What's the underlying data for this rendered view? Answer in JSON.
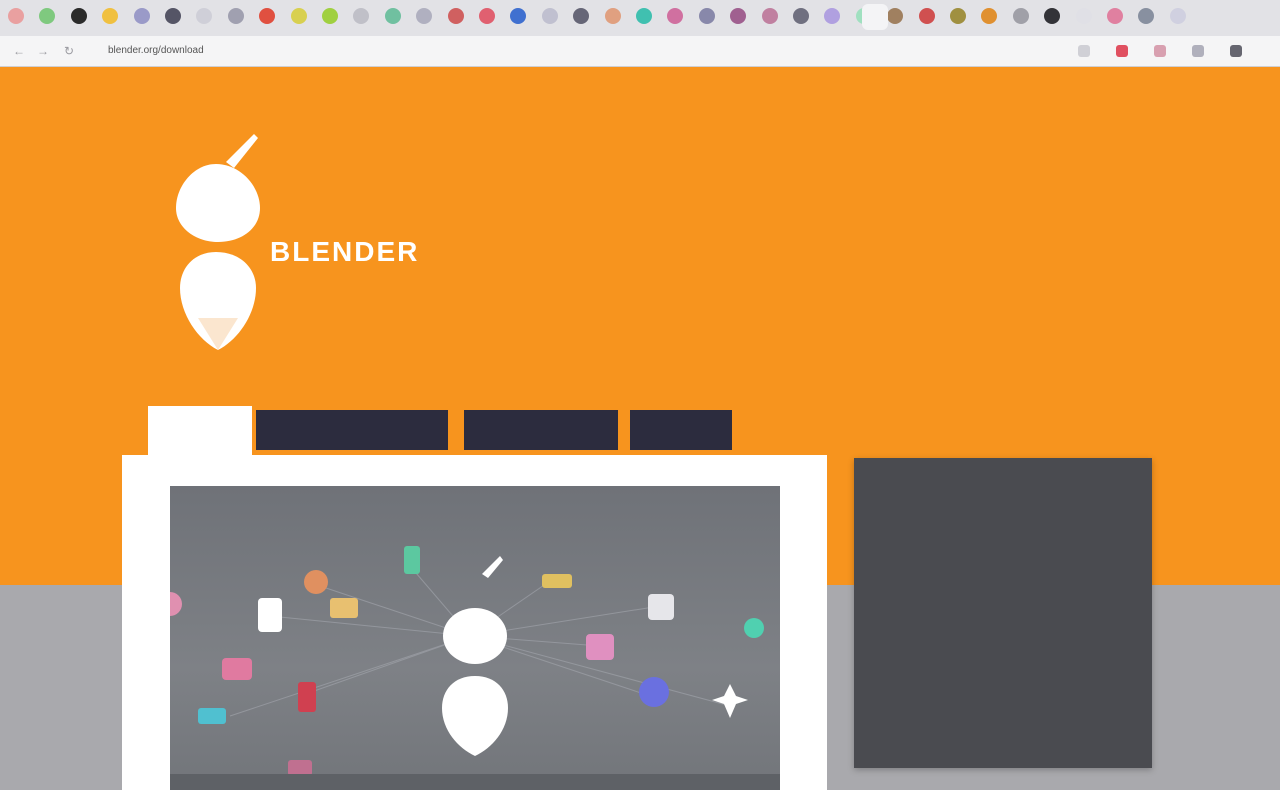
{
  "browser": {
    "url": "blender.org/download",
    "tab_colors": [
      "#e9a0a0",
      "#7fc97f",
      "#2b2b2b",
      "#f0c040",
      "#9a9ac8",
      "#555566",
      "#cfcfd8",
      "#a0a0b0",
      "#e05040",
      "#d8d050",
      "#a0d040",
      "#c0c0c8",
      "#70c0a0",
      "#b0b0c0",
      "#d06060",
      "#e06070",
      "#4070d0",
      "#c0c0d0",
      "#666677",
      "#e0a080",
      "#40c0b0",
      "#d070a0",
      "#8888aa",
      "#a06090",
      "#c080a0",
      "#707080",
      "#b0a0e0",
      "#a0e0c0",
      "#a08060",
      "#d05050",
      "#a09040",
      "#e09030",
      "#a0a0a8",
      "#333338",
      "#e0e0e6",
      "#e080a0",
      "#8890a0",
      "#d0d0e0"
    ],
    "extension_colors": [
      "#d0d0d6",
      "#e05060",
      "#d8a0b0",
      "#b0b0bc",
      "#666670"
    ],
    "icons": [
      "back-icon",
      "forward-icon",
      "reload-icon"
    ]
  },
  "header": {
    "brand": "BLENDER",
    "tagline": ""
  },
  "tabs": [
    {
      "label": "",
      "active": true
    },
    {
      "label": "",
      "active": false
    },
    {
      "label": "",
      "active": false
    },
    {
      "label": "",
      "active": false
    }
  ],
  "sidebar": {
    "heading_1": "",
    "link_1": "",
    "heading_2": "",
    "text_1": "",
    "text_2": "",
    "link_2": ""
  },
  "colors": {
    "hero": "#f7941e",
    "band": "#a9a9ad",
    "tab_dark": "#2c2c3e",
    "sidebar": "#4a4b50",
    "link": "#8b93e6"
  }
}
